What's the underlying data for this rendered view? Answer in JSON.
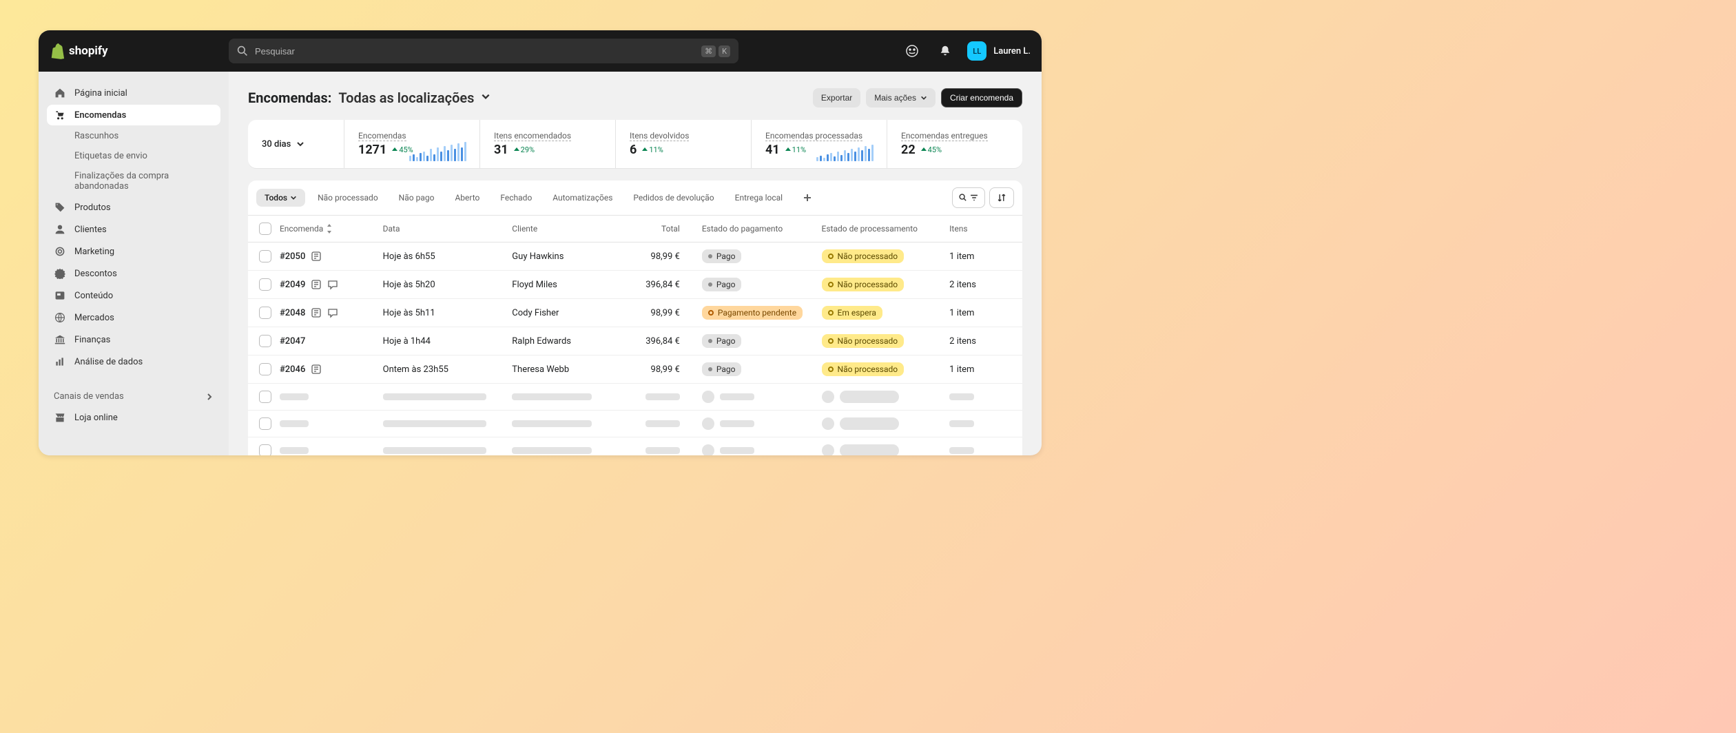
{
  "brand": "shopify",
  "search": {
    "placeholder": "Pesquisar",
    "kbd1": "⌘",
    "kbd2": "K"
  },
  "user": {
    "initials": "LL",
    "name": "Lauren L."
  },
  "sidebar": {
    "items": [
      {
        "label": "Página inicial"
      },
      {
        "label": "Encomendas"
      },
      {
        "label": "Produtos"
      },
      {
        "label": "Clientes"
      },
      {
        "label": "Marketing"
      },
      {
        "label": "Descontos"
      },
      {
        "label": "Conteúdo"
      },
      {
        "label": "Mercados"
      },
      {
        "label": "Finanças"
      },
      {
        "label": "Análise de dados"
      }
    ],
    "sub": [
      {
        "label": "Rascunhos"
      },
      {
        "label": "Etiquetas de envio"
      },
      {
        "label": "Finalizações da compra abandonadas"
      }
    ],
    "channels_label": "Canais de vendas",
    "online_store": "Loja online"
  },
  "page": {
    "title": "Encomendas:",
    "subtitle": "Todas as localizações",
    "export": "Exportar",
    "more": "Mais ações",
    "create": "Criar encomenda"
  },
  "metrics": {
    "period": "30 dias",
    "cards": [
      {
        "label": "Encomendas",
        "value": "1271",
        "delta": "45%"
      },
      {
        "label": "Itens encomendados",
        "value": "31",
        "delta": "29%"
      },
      {
        "label": "Itens devolvidos",
        "value": "6",
        "delta": "11%"
      },
      {
        "label": "Encomendas processadas",
        "value": "41",
        "delta": "11%"
      },
      {
        "label": "Encomendas entregues",
        "value": "22",
        "delta": "45%"
      }
    ]
  },
  "tabs": [
    "Todos",
    "Não processado",
    "Não pago",
    "Aberto",
    "Fechado",
    "Automatizações",
    "Pedidos de devolução",
    "Entrega local"
  ],
  "columns": {
    "order": "Encomenda",
    "date": "Data",
    "customer": "Cliente",
    "total": "Total",
    "payment": "Estado do pagamento",
    "fulfillment": "Estado de processamento",
    "items": "Itens"
  },
  "orders": [
    {
      "id": "#2050",
      "date": "Hoje às 6h55",
      "customer": "Guy Hawkins",
      "total": "98,99 €",
      "payment": "Pago",
      "payment_kind": "gray",
      "fulfillment": "Não processado",
      "fulfillment_kind": "yellow",
      "items": "1 item",
      "comment": true,
      "note": false
    },
    {
      "id": "#2049",
      "date": "Hoje às 5h20",
      "customer": "Floyd Miles",
      "total": "396,84 €",
      "payment": "Pago",
      "payment_kind": "gray",
      "fulfillment": "Não processado",
      "fulfillment_kind": "yellow",
      "items": "2 itens",
      "comment": true,
      "note": true
    },
    {
      "id": "#2048",
      "date": "Hoje às 5h11",
      "customer": "Cody Fisher",
      "total": "98,99 €",
      "payment": "Pagamento pendente",
      "payment_kind": "orange",
      "fulfillment": "Em espera",
      "fulfillment_kind": "yellow",
      "items": "1 item",
      "comment": true,
      "note": true
    },
    {
      "id": "#2047",
      "date": "Hoje à 1h44",
      "customer": "Ralph Edwards",
      "total": "396,84 €",
      "payment": "Pago",
      "payment_kind": "gray",
      "fulfillment": "Não processado",
      "fulfillment_kind": "yellow",
      "items": "2 itens",
      "comment": false,
      "note": false
    },
    {
      "id": "#2046",
      "date": "Ontem às 23h55",
      "customer": "Theresa Webb",
      "total": "98,99 €",
      "payment": "Pago",
      "payment_kind": "gray",
      "fulfillment": "Não processado",
      "fulfillment_kind": "yellow",
      "items": "1 item",
      "comment": true,
      "note": false
    }
  ],
  "skeleton_rows": 4
}
